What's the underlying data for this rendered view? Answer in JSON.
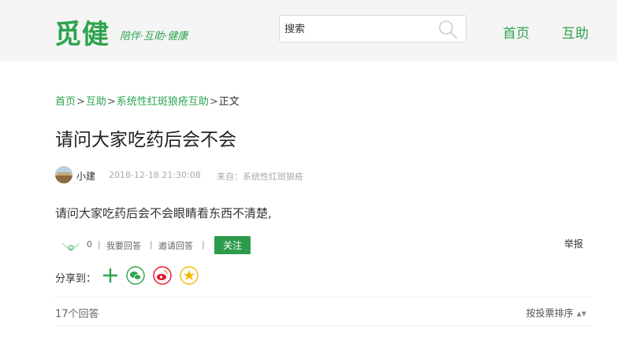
{
  "header": {
    "logo": "觅健",
    "tagline": "陪伴·互助·健康",
    "search": {
      "placeholder": "搜索",
      "value": ""
    },
    "nav": [
      {
        "label": "首页"
      },
      {
        "label": "互助"
      }
    ]
  },
  "breadcrumb": {
    "items": [
      "首页",
      "互助",
      "系统性红斑狼疮互助"
    ],
    "separator": ">",
    "current": "正文"
  },
  "question": {
    "title": "请问大家吃药后会不会",
    "author": "小建",
    "date": "2018-12-18 21:30:08",
    "source": "来自：系统性红斑狼疮",
    "body": "请问大家吃药后会不会眼睛看东西不清楚,"
  },
  "actions": {
    "count": "0",
    "separator": "|",
    "answer_label": "我要回答",
    "invite_label": "邀请回答",
    "follow_label": "关注",
    "report_label": "举报"
  },
  "share": {
    "label": "分享到：",
    "buttons": [
      "plus-icon",
      "wechat-icon",
      "weibo-icon",
      "qzone-icon"
    ]
  },
  "answers": {
    "count_label": "17个回答",
    "sort_label": "按投票排序"
  },
  "colors": {
    "brand_green": "#2ea44f",
    "button_green": "#2d9b4b",
    "header_bg": "#f5f5f5",
    "weibo_red": "#e6162d",
    "qzone_yellow": "#f5b800"
  }
}
